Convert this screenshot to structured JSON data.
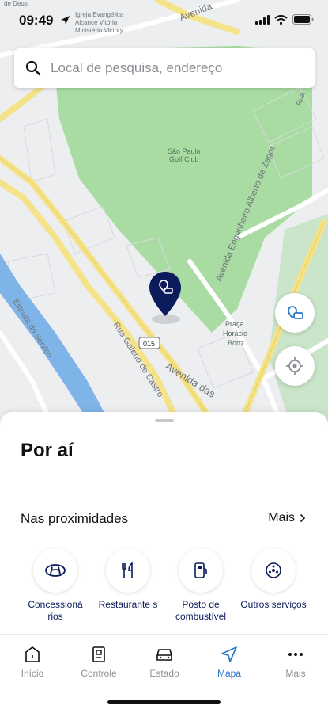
{
  "status_bar": {
    "time": "09:49"
  },
  "search": {
    "placeholder": "Local de pesquisa, endereço"
  },
  "map": {
    "labels": {
      "de_deus": "de Deus",
      "church_1": "Igreja Evangélica",
      "church_2": "Alcance Vitória",
      "church_3": "Ministério Victory",
      "avenida_top": "Avenida",
      "golf": "São Paulo\nGolf Club",
      "rua_galeno": "Rua Galeno de Castro",
      "avenida_das": "Avenida das",
      "route": "015",
      "praca_1": "Praça",
      "praca_2": "Horácio",
      "praca_3": "Bortz",
      "avenida_eng": "Avenida Engenheiro Alberto de Zagot",
      "estrada": "Estrada do Serviço",
      "rua_side": "Rua"
    }
  },
  "sheet": {
    "title": "Por aí",
    "nearby_label": "Nas proximidades",
    "more_label": "Mais",
    "categories": [
      {
        "icon": "hyundai-logo-icon",
        "label": "Concessioná rios"
      },
      {
        "icon": "fork-knife-icon",
        "label": "Restaurante s"
      },
      {
        "icon": "fuel-pump-icon",
        "label": "Posto de combustível"
      },
      {
        "icon": "services-icon",
        "label": "Outros serviços"
      }
    ]
  },
  "tabs": [
    {
      "icon": "home-icon",
      "label": "Início",
      "active": false
    },
    {
      "icon": "remote-icon",
      "label": "Controle",
      "active": false
    },
    {
      "icon": "car-icon",
      "label": "Estado",
      "active": false
    },
    {
      "icon": "navigation-icon",
      "label": "Mapa",
      "active": true
    },
    {
      "icon": "more-icon",
      "label": "Mais",
      "active": false
    }
  ],
  "colors": {
    "accent": "#2a76c9",
    "pin": "#0b1b5b",
    "park_green": "#a8dca2",
    "road_yellow": "#f5e38a",
    "water_blue": "#7fb4e8"
  }
}
